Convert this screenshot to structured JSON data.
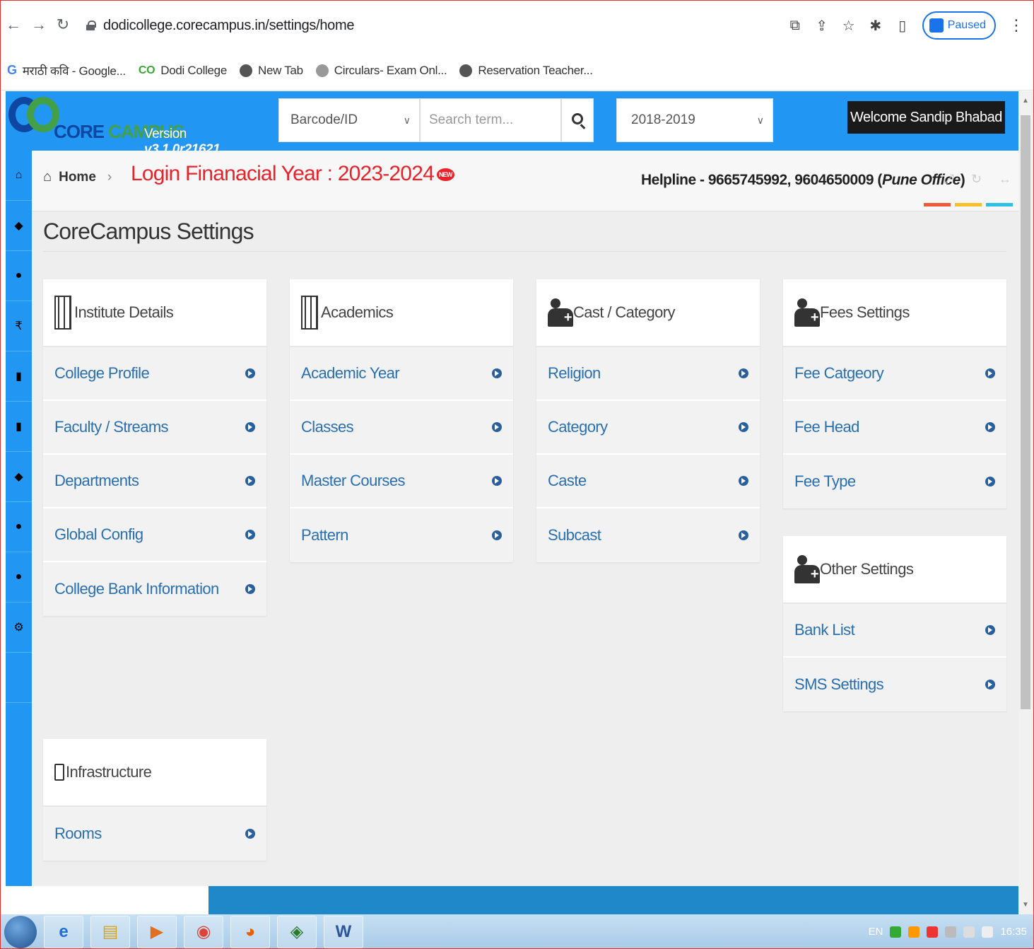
{
  "browser": {
    "url": "dodicollege.corecampus.in/settings/home",
    "profile_status": "Paused",
    "bookmarks": [
      {
        "label": "मराठी कवि - Google...",
        "icon": "google-icon"
      },
      {
        "label": "Dodi College",
        "icon": "corecampus-icon"
      },
      {
        "label": "New Tab",
        "icon": "globe-icon"
      },
      {
        "label": "Circulars- Exam Onl...",
        "icon": "emblem-icon"
      },
      {
        "label": "Reservation Teacher...",
        "icon": "globe-icon"
      }
    ]
  },
  "header": {
    "logo_core": "CORE",
    "logo_campus": "CAMPUS",
    "version_prefix": "Version",
    "version": "v3.1.0r21621",
    "search_type": "Barcode/ID",
    "search_placeholder": "Search term...",
    "academic_year": "2018-2019",
    "welcome": "Welcome Sandip Bhabad"
  },
  "breadcrumb": {
    "home": "Home",
    "login_year": "Login Finanacial Year : 2023-2024",
    "badge": "NEW",
    "helpline_prefix": "Helpline - 9665745992, 9604650009 (",
    "helpline_office": "Pune Office",
    "helpline_suffix": ")"
  },
  "page": {
    "title": "CoreCampus Settings"
  },
  "cards": {
    "institute": {
      "title": "Institute Details",
      "icon": "building-icon",
      "items": [
        "College Profile",
        "Faculty / Streams",
        "Departments",
        "Global Config",
        "College Bank Information"
      ]
    },
    "academics": {
      "title": "Academics",
      "icon": "building-icon",
      "items": [
        "Academic Year",
        "Classes",
        "Master Courses",
        "Pattern"
      ]
    },
    "cast": {
      "title": "Cast / Category",
      "icon": "user-plus-icon",
      "items": [
        "Religion",
        "Category",
        "Caste",
        "Subcast"
      ]
    },
    "fees": {
      "title": "Fees Settings",
      "icon": "user-plus-icon",
      "items": [
        "Fee Catgeory",
        "Fee Head",
        "Fee Type"
      ]
    },
    "other": {
      "title": "Other Settings",
      "icon": "user-plus-icon",
      "items": [
        "Bank List",
        "SMS Settings"
      ]
    },
    "infra": {
      "title": "Infrastructure",
      "icon": "mobile-icon",
      "items": [
        "Rooms"
      ]
    }
  },
  "colors": {
    "header_blue": "#2196f3",
    "login_red": "#e8232a",
    "link_blue": "#2a6fb0",
    "accent_bars": [
      "#f05a3a",
      "#f7c02f",
      "#2bc0e4"
    ]
  },
  "taskbar": {
    "lang": "EN",
    "time": "16:35"
  }
}
